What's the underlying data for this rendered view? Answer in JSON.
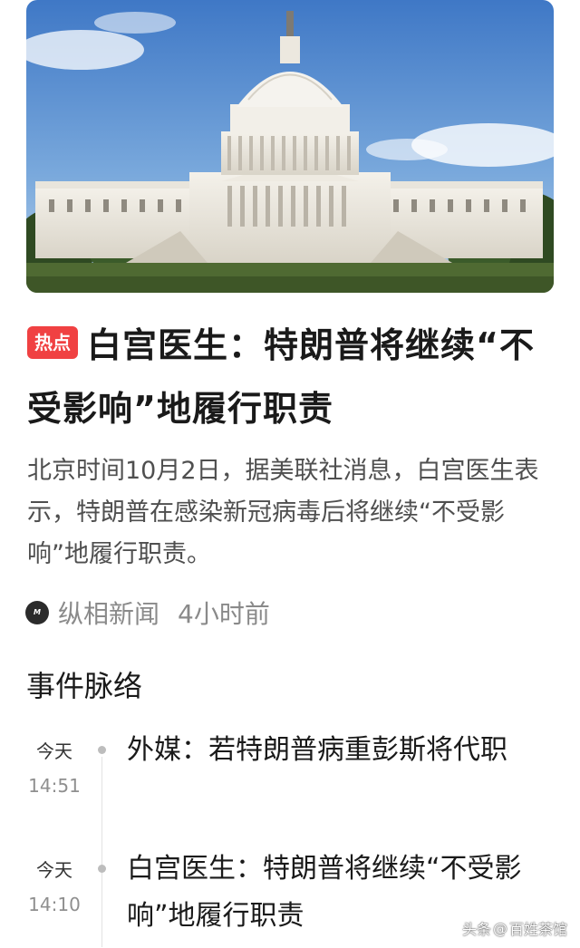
{
  "article": {
    "badge": "热点",
    "title": "白宫医生：特朗普将继续“不受影响”地履行职责",
    "summary": "北京时间10月2日，据美联社消息，白宫医生表示，特朗普在感染新冠病毒后将继续“不受影响”地履行职责。",
    "source": "纵相新闻",
    "time": "4小时前"
  },
  "timeline": {
    "title": "事件脉络",
    "items": [
      {
        "day": "今天",
        "time": "14:51",
        "text": "外媒：若特朗普病重彭斯将代职"
      },
      {
        "day": "今天",
        "time": "14:10",
        "text": "白宫医生：特朗普将继续“不受影响”地履行职责"
      }
    ]
  },
  "watermark": {
    "platform": "头条",
    "at": "@",
    "account": "百姓茶馆"
  },
  "colors": {
    "badge": "#f04142",
    "title": "#1a1a1a",
    "summary": "#4f4f4f",
    "meta": "#8a8a8a"
  },
  "icons": {
    "hero": "capitol-building-image",
    "source_logo": "source-logo-icon",
    "timeline_dot": "timeline-dot-icon"
  }
}
